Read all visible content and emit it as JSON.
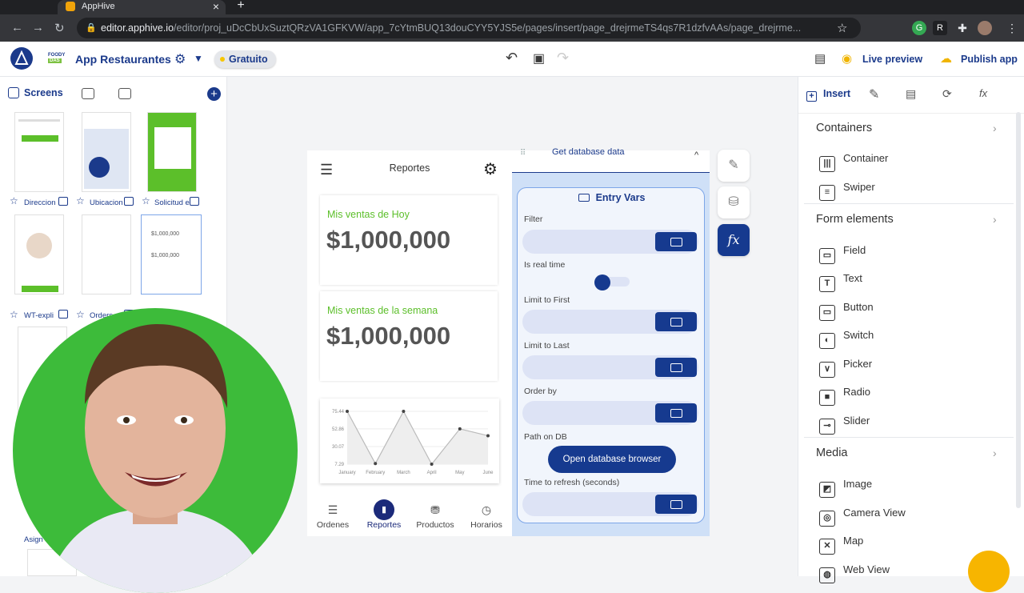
{
  "browser": {
    "tab_title": "AppHive",
    "url_host": "editor.apphive.io",
    "url_path": "/editor/proj_uDcCbUxSuztQRzVA1GFKVW/app_7cYtmBUQ13douCYY5YJS5e/pages/insert/page_drejrmeTS4qs7R1dzfvAAs/page_drejrme..."
  },
  "header": {
    "brand_line1": "FOODY",
    "brand_line2": "DAS",
    "app_name": "App Restaurantes",
    "plan_badge": "Gratuito",
    "live_preview": "Live preview",
    "publish_app": "Publish app"
  },
  "left_panel": {
    "tab_label": "Screens",
    "screens": [
      {
        "label": "Direccion"
      },
      {
        "label": "Ubicacion"
      },
      {
        "label": "Solicitud e"
      },
      {
        "label": "WT-expli"
      },
      {
        "label": "Orders"
      },
      {
        "label": "Asign"
      }
    ]
  },
  "phone": {
    "title": "Reportes",
    "card1": {
      "label": "Mis ventas de Hoy",
      "value": "$1,000,000"
    },
    "card2": {
      "label": "Mis ventas de la semana",
      "value": "$1,000,000"
    },
    "nav": [
      {
        "label": "Ordenes",
        "icon": "list-icon"
      },
      {
        "label": "Reportes",
        "icon": "chart-icon"
      },
      {
        "label": "Productos",
        "icon": "food-icon"
      },
      {
        "label": "Horarios",
        "icon": "clock-icon"
      }
    ]
  },
  "chart_data": {
    "type": "area",
    "categories": [
      "January",
      "February",
      "March",
      "April",
      "May",
      "June"
    ],
    "values": [
      75.44,
      8,
      75.44,
      7.29,
      52.86,
      44
    ],
    "yticks": [
      "75.44",
      "52.86",
      "30.07",
      "7.29"
    ],
    "ylim": [
      7.29,
      75.44
    ]
  },
  "entry_vars": {
    "top_label": "Get database data",
    "title": "Entry Vars",
    "filter_label": "Filter",
    "realtime_label": "Is real time",
    "limit_first_label": "Limit to First",
    "limit_last_label": "Limit to Last",
    "order_by_label": "Order by",
    "path_label": "Path on DB",
    "db_button": "Open database browser",
    "refresh_label": "Time to refresh (seconds)"
  },
  "right_panel": {
    "insert_tab": "Insert",
    "sections": {
      "containers": "Containers",
      "form_elements": "Form elements",
      "media": "Media"
    },
    "containers": [
      "Container",
      "Swiper"
    ],
    "form_elements": [
      "Field",
      "Text",
      "Button",
      "Switch",
      "Picker",
      "Radio",
      "Slider"
    ],
    "media": [
      "Image",
      "Camera View",
      "Map",
      "Web View"
    ]
  },
  "colors": {
    "brand": "#1b3a8b",
    "accent_green": "#5cbf2a",
    "button": "#163a8f"
  }
}
